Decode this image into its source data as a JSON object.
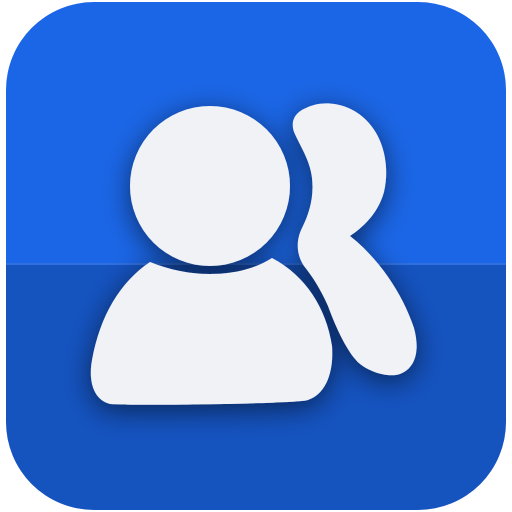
{
  "icon": {
    "name": "contacts-app-icon",
    "glyph": "people-icon",
    "colors": {
      "tile_top": "#1b66e6",
      "tile_bottom": "#1553bf",
      "divider": "#2f6fe0",
      "figure_fill": "#f1f2f6",
      "shadow": "#0a2a6a"
    }
  }
}
